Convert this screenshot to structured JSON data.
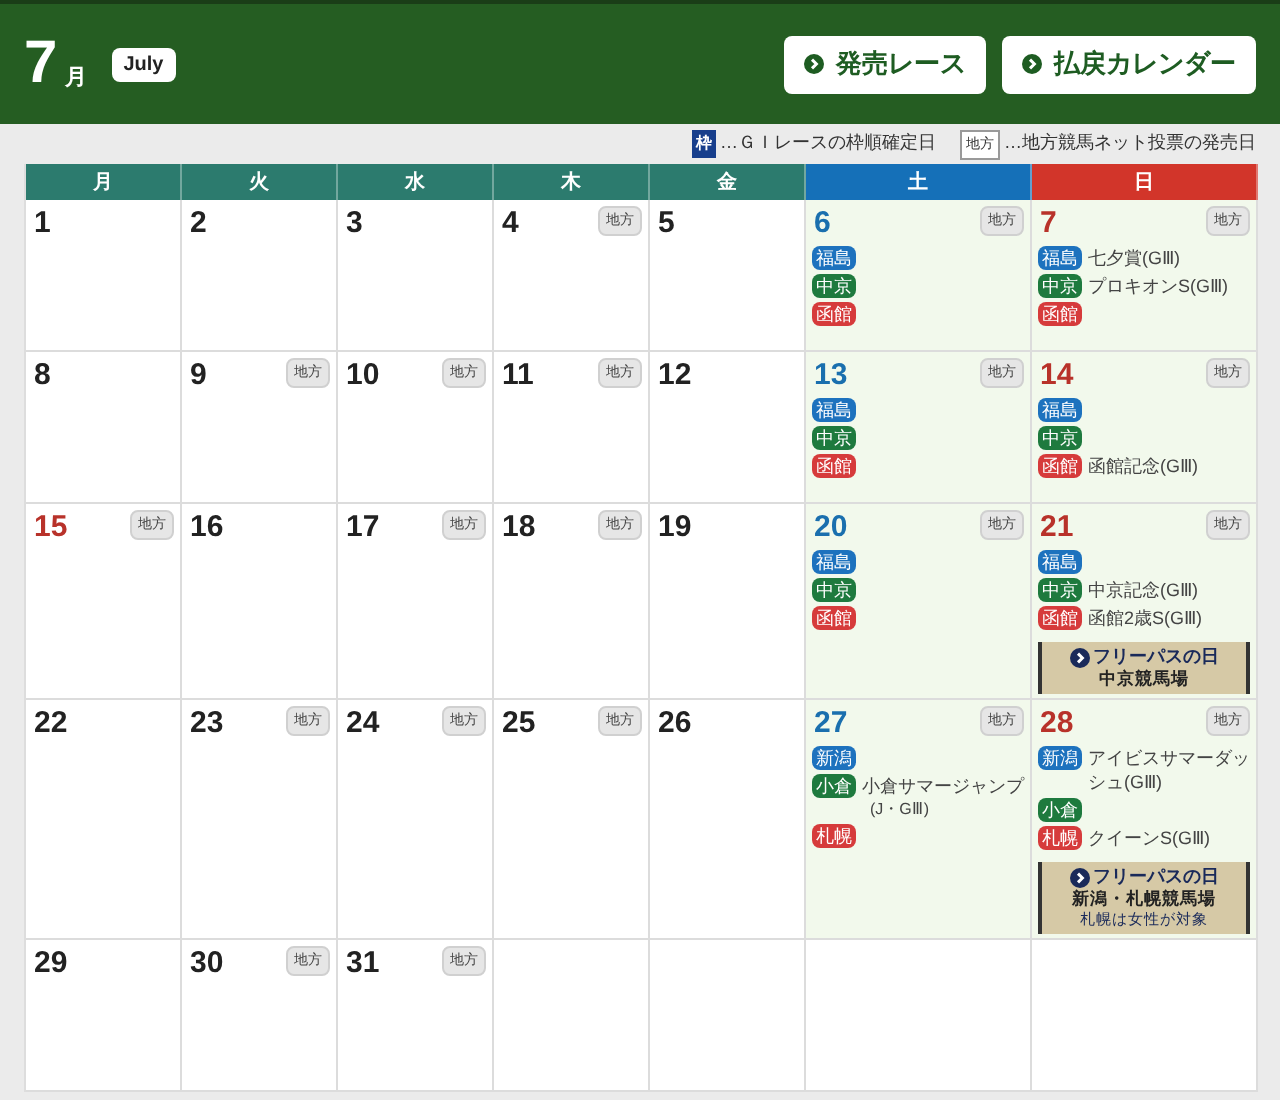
{
  "header": {
    "month": "7",
    "month_unit": "月",
    "month_en": "July",
    "buttons": [
      "発売レース",
      "払戻カレンダー"
    ]
  },
  "legend": [
    {
      "kind": "frame",
      "mark": "枠",
      "text": "…ＧＩレースの枠順確定日"
    },
    {
      "kind": "chiho",
      "mark": "地方",
      "text": "…地方競馬ネット投票の発売日"
    }
  ],
  "weekdays": [
    {
      "label": "月",
      "kind": "weekday"
    },
    {
      "label": "火",
      "kind": "weekday"
    },
    {
      "label": "水",
      "kind": "weekday"
    },
    {
      "label": "木",
      "kind": "weekday"
    },
    {
      "label": "金",
      "kind": "weekday"
    },
    {
      "label": "土",
      "kind": "saturday"
    },
    {
      "label": "日",
      "kind": "sunday"
    }
  ],
  "weeks": [
    [
      {
        "date": "1",
        "kind": "weekday"
      },
      {
        "date": "2",
        "kind": "weekday"
      },
      {
        "date": "3",
        "kind": "weekday"
      },
      {
        "date": "4",
        "kind": "weekday",
        "chiho": "地方"
      },
      {
        "date": "5",
        "kind": "weekday"
      },
      {
        "date": "6",
        "kind": "saturday",
        "chiho": "地方",
        "venues": [
          {
            "name": "福島",
            "color": "#1d72be"
          },
          {
            "name": "中京",
            "color": "#1e7a3e"
          },
          {
            "name": "函館",
            "color": "#d63b3b"
          }
        ]
      },
      {
        "date": "7",
        "kind": "sunday",
        "chiho": "地方",
        "venues": [
          {
            "name": "福島",
            "color": "#1d72be",
            "race": "七夕賞(GⅢ)"
          },
          {
            "name": "中京",
            "color": "#1e7a3e",
            "race": "プロキオンS(GⅢ)"
          },
          {
            "name": "函館",
            "color": "#d63b3b"
          }
        ]
      }
    ],
    [
      {
        "date": "8",
        "kind": "weekday"
      },
      {
        "date": "9",
        "kind": "weekday",
        "chiho": "地方"
      },
      {
        "date": "10",
        "kind": "weekday",
        "chiho": "地方"
      },
      {
        "date": "11",
        "kind": "weekday",
        "chiho": "地方"
      },
      {
        "date": "12",
        "kind": "weekday"
      },
      {
        "date": "13",
        "kind": "saturday",
        "chiho": "地方",
        "venues": [
          {
            "name": "福島",
            "color": "#1d72be"
          },
          {
            "name": "中京",
            "color": "#1e7a3e"
          },
          {
            "name": "函館",
            "color": "#d63b3b"
          }
        ]
      },
      {
        "date": "14",
        "kind": "sunday",
        "chiho": "地方",
        "venues": [
          {
            "name": "福島",
            "color": "#1d72be"
          },
          {
            "name": "中京",
            "color": "#1e7a3e"
          },
          {
            "name": "函館",
            "color": "#d63b3b",
            "race": "函館記念(GⅢ)"
          }
        ]
      }
    ],
    [
      {
        "date": "15",
        "kind": "holiday",
        "chiho": "地方"
      },
      {
        "date": "16",
        "kind": "weekday"
      },
      {
        "date": "17",
        "kind": "weekday",
        "chiho": "地方"
      },
      {
        "date": "18",
        "kind": "weekday",
        "chiho": "地方"
      },
      {
        "date": "19",
        "kind": "weekday"
      },
      {
        "date": "20",
        "kind": "saturday",
        "chiho": "地方",
        "venues": [
          {
            "name": "福島",
            "color": "#1d72be"
          },
          {
            "name": "中京",
            "color": "#1e7a3e"
          },
          {
            "name": "函館",
            "color": "#d63b3b"
          }
        ]
      },
      {
        "date": "21",
        "kind": "sunday",
        "chiho": "地方",
        "venues": [
          {
            "name": "福島",
            "color": "#1d72be"
          },
          {
            "name": "中京",
            "color": "#1e7a3e",
            "race": "中京記念(GⅢ)"
          },
          {
            "name": "函館",
            "color": "#d63b3b",
            "race": "函館2歳S(GⅢ)"
          }
        ],
        "free_pass": {
          "title": "フリーパスの日",
          "venue": "中京競馬場"
        }
      }
    ],
    [
      {
        "date": "22",
        "kind": "weekday"
      },
      {
        "date": "23",
        "kind": "weekday",
        "chiho": "地方"
      },
      {
        "date": "24",
        "kind": "weekday",
        "chiho": "地方"
      },
      {
        "date": "25",
        "kind": "weekday",
        "chiho": "地方"
      },
      {
        "date": "26",
        "kind": "weekday"
      },
      {
        "date": "27",
        "kind": "saturday",
        "chiho": "地方",
        "venues": [
          {
            "name": "新潟",
            "color": "#1d72be"
          },
          {
            "name": "小倉",
            "color": "#1e7a3e",
            "race": "小倉サマージャンプ",
            "race_note": "(J・GⅢ)"
          },
          {
            "name": "札幌",
            "color": "#d63b3b"
          }
        ]
      },
      {
        "date": "28",
        "kind": "sunday",
        "chiho": "地方",
        "venues": [
          {
            "name": "新潟",
            "color": "#1d72be",
            "race": "アイビスサマーダッシュ(GⅢ)"
          },
          {
            "name": "小倉",
            "color": "#1e7a3e"
          },
          {
            "name": "札幌",
            "color": "#d63b3b",
            "race": "クイーンS(GⅢ)"
          }
        ],
        "free_pass": {
          "title": "フリーパスの日",
          "venue": "新潟・札幌競馬場",
          "note": "札幌は女性が対象"
        }
      }
    ],
    [
      {
        "date": "29",
        "kind": "weekday"
      },
      {
        "date": "30",
        "kind": "weekday",
        "chiho": "地方"
      },
      {
        "date": "31",
        "kind": "weekday",
        "chiho": "地方"
      },
      {
        "kind": "blank"
      },
      {
        "kind": "blank"
      },
      {
        "kind": "blank"
      },
      {
        "kind": "blank"
      }
    ]
  ]
}
